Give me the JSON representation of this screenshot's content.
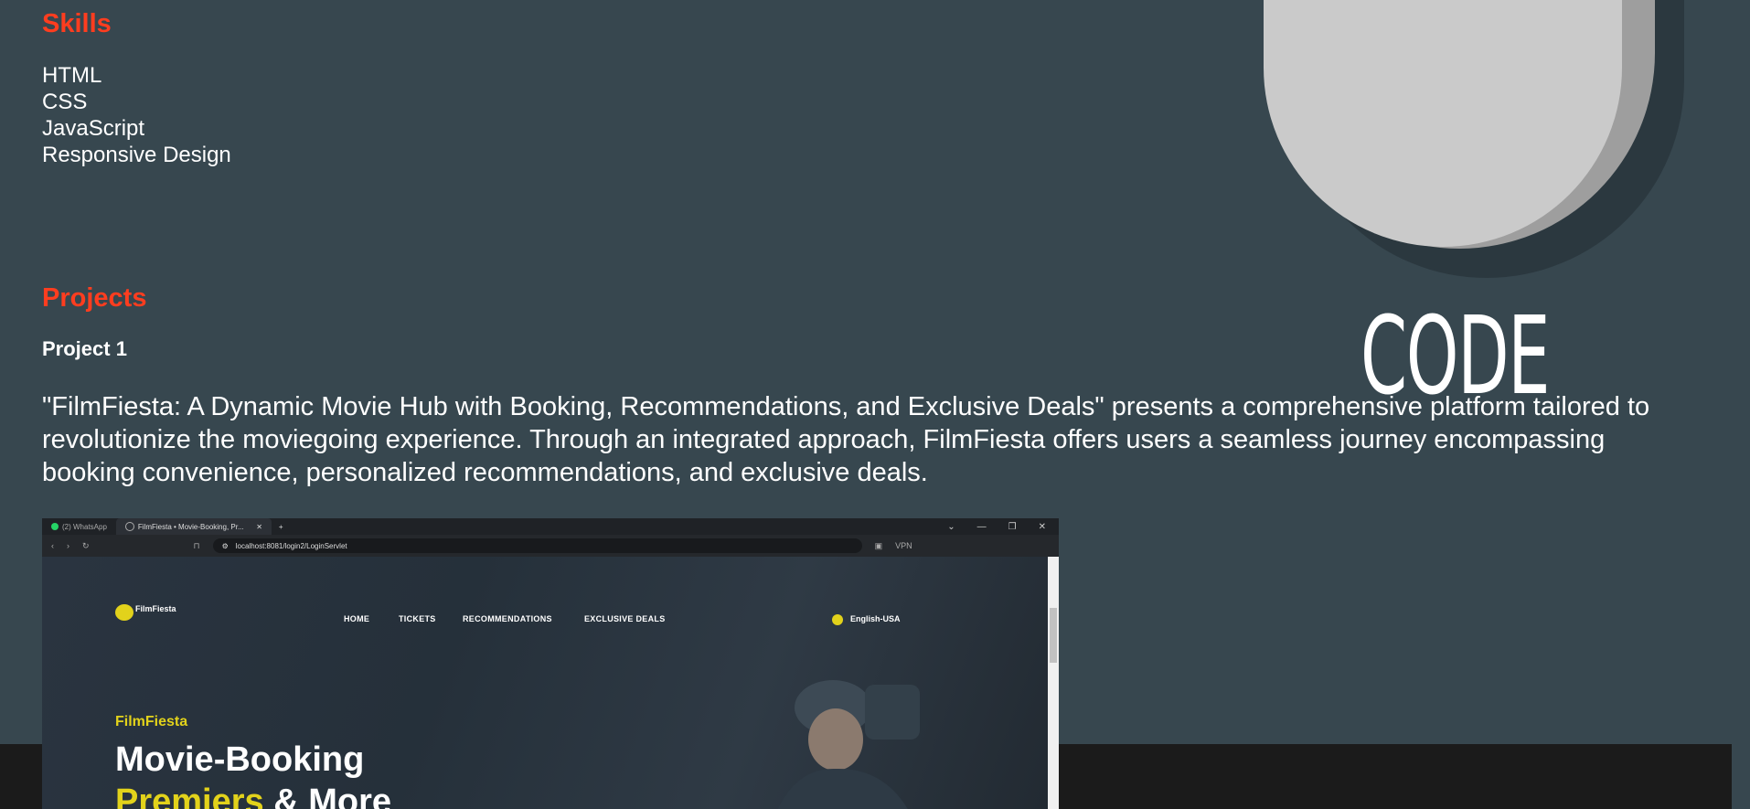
{
  "skills": {
    "title": "Skills",
    "items": [
      "HTML",
      "CSS",
      "JavaScript",
      "Responsive Design"
    ]
  },
  "projects": {
    "title": "Projects",
    "items": [
      {
        "name": "Project 1",
        "description": "\"FilmFiesta: A Dynamic Movie Hub with Booking, Recommendations, and Exclusive Deals\" presents a comprehensive platform tailored to revolutionize the moviegoing experience. Through an integrated approach, FilmFiesta offers users a seamless journey encompassing booking convenience, personalized recommendations, and exclusive deals."
      }
    ]
  },
  "hero_graphic": {
    "text": "CODE"
  },
  "screenshot": {
    "tabs": [
      "(2) WhatsApp",
      "FilmFiesta • Movie-Booking, Pr..."
    ],
    "url": "localhost:8081/login2/LoginServlet",
    "brand": "FilmFiesta",
    "nav": [
      "HOME",
      "TICKETS",
      "RECOMMENDATIONS",
      "EXCLUSIVE DEALS"
    ],
    "language": "English-USA",
    "hero_brand": "FilmFiesta",
    "hero_title": "Movie-Booking",
    "hero_highlight": "Premiers",
    "hero_rest": " & More",
    "vpn": "VPN"
  }
}
